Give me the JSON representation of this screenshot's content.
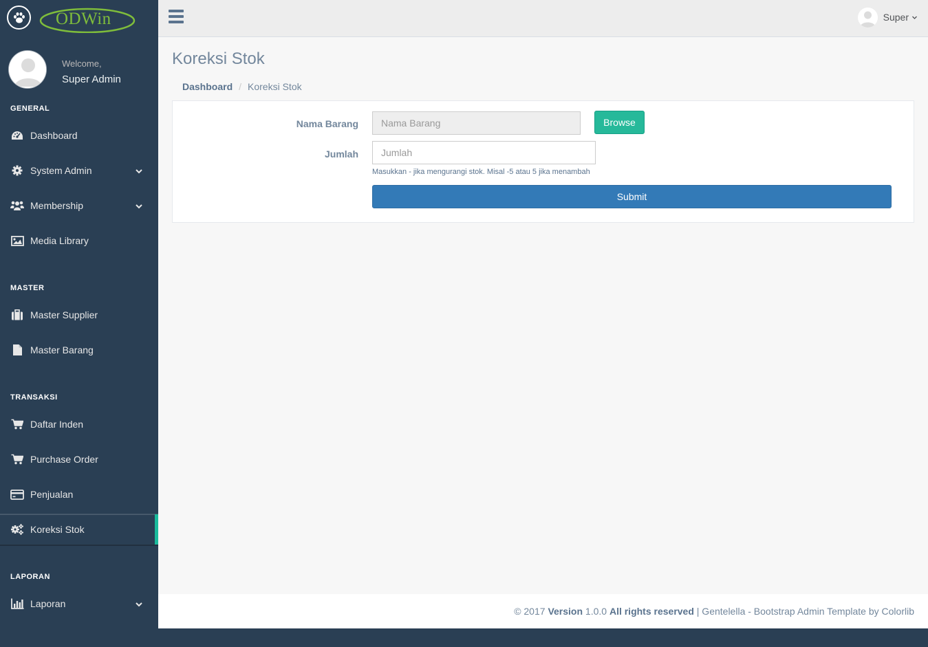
{
  "brand": {
    "logo_text": "ODWin"
  },
  "profile": {
    "welcome": "Welcome,",
    "name": "Super Admin"
  },
  "sidebar": {
    "sections": [
      {
        "title": "GENERAL"
      },
      {
        "title": "MASTER"
      },
      {
        "title": "TRANSAKSI"
      },
      {
        "title": "LAPORAN"
      }
    ],
    "items": [
      {
        "label": "Dashboard",
        "icon": "dashboard-icon"
      },
      {
        "label": "System Admin",
        "icon": "gear-icon",
        "has_submenu": true
      },
      {
        "label": "Membership",
        "icon": "users-icon",
        "has_submenu": true
      },
      {
        "label": "Media Library",
        "icon": "image-icon"
      },
      {
        "label": "Master Supplier",
        "icon": "briefcase-icon"
      },
      {
        "label": "Master Barang",
        "icon": "file-icon"
      },
      {
        "label": "Daftar Inden",
        "icon": "cart-icon"
      },
      {
        "label": "Purchase Order",
        "icon": "cart-icon"
      },
      {
        "label": "Penjualan",
        "icon": "credit-card-icon"
      },
      {
        "label": "Koreksi Stok",
        "icon": "gears-icon",
        "active": true
      },
      {
        "label": "Laporan",
        "icon": "bar-chart-icon",
        "has_submenu": true
      }
    ]
  },
  "topnav": {
    "user_label": "Super"
  },
  "page": {
    "title": "Koreksi Stok",
    "breadcrumb": {
      "home": "Dashboard",
      "separator": "/",
      "current": "Koreksi Stok"
    }
  },
  "form": {
    "nama_barang": {
      "label": "Nama Barang",
      "placeholder": "Nama Barang",
      "value": ""
    },
    "browse_label": "Browse",
    "jumlah": {
      "label": "Jumlah",
      "placeholder": "Jumlah",
      "value": ""
    },
    "help_text": "Masukkan - jika mengurangi stok. Misal -5 atau 5 jika menambah",
    "submit_label": "Submit"
  },
  "footer": {
    "copyright": "© 2017",
    "version_label": "Version",
    "version": "1.0.0",
    "rights": "All rights reserved",
    "credit": "| Gentelella - Bootstrap Admin Template by",
    "credit_link": "Colorlib"
  },
  "colors": {
    "sidebar_bg": "#2A3F54",
    "accent_green": "#1ABB9C",
    "browse_button": "#26B99A",
    "submit_button": "#337AB7",
    "text_muted": "#73879C"
  }
}
